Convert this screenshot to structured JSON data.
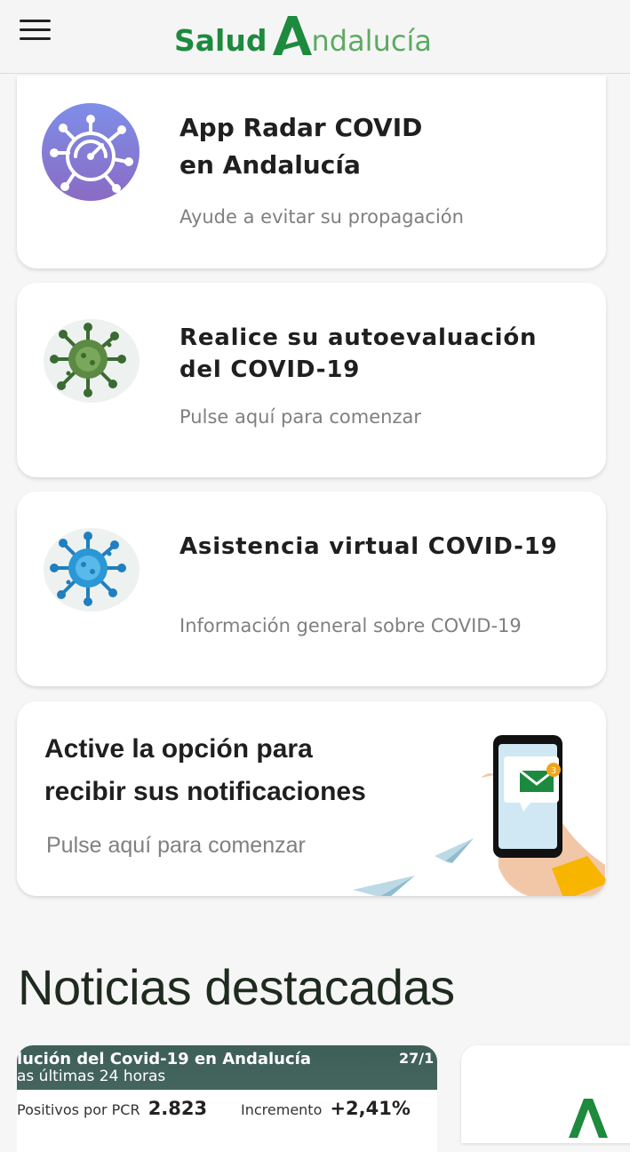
{
  "header": {
    "logo_part1": "Salud",
    "logo_part2": "ndalucía",
    "brand_color": "#1d8a3e"
  },
  "cards": [
    {
      "title_line1": "App Radar COVID",
      "title_line2": "en Andalucía",
      "subtitle": "Ayude a evitar su propagación",
      "icon": "radar-covid-icon"
    },
    {
      "title_line1": "Realice su autoevaluación",
      "title_line2": "del COVID-19",
      "subtitle": "Pulse aquí para comenzar",
      "icon": "green-virus-icon"
    },
    {
      "title_line1": "Asistencia virtual COVID-19",
      "subtitle": "Información general sobre COVID-19",
      "icon": "blue-virus-icon"
    }
  ],
  "notifications": {
    "title_line1": "Active la opción para",
    "title_line2": "recibir sus notificaciones",
    "subtitle": "Pulse aquí para comenzar",
    "badge_count": "3"
  },
  "news": {
    "section_title": "Noticias destacadas",
    "items": [
      {
        "headline": "lución del Covid-19 en Andalucía",
        "subheadline": "as últimas 24 horas",
        "date": "27/1",
        "pcr_label": "Positivos por PCR",
        "pcr_value": "2.823",
        "increase_label": "Incremento",
        "increase_value": "+2,41%"
      }
    ]
  }
}
